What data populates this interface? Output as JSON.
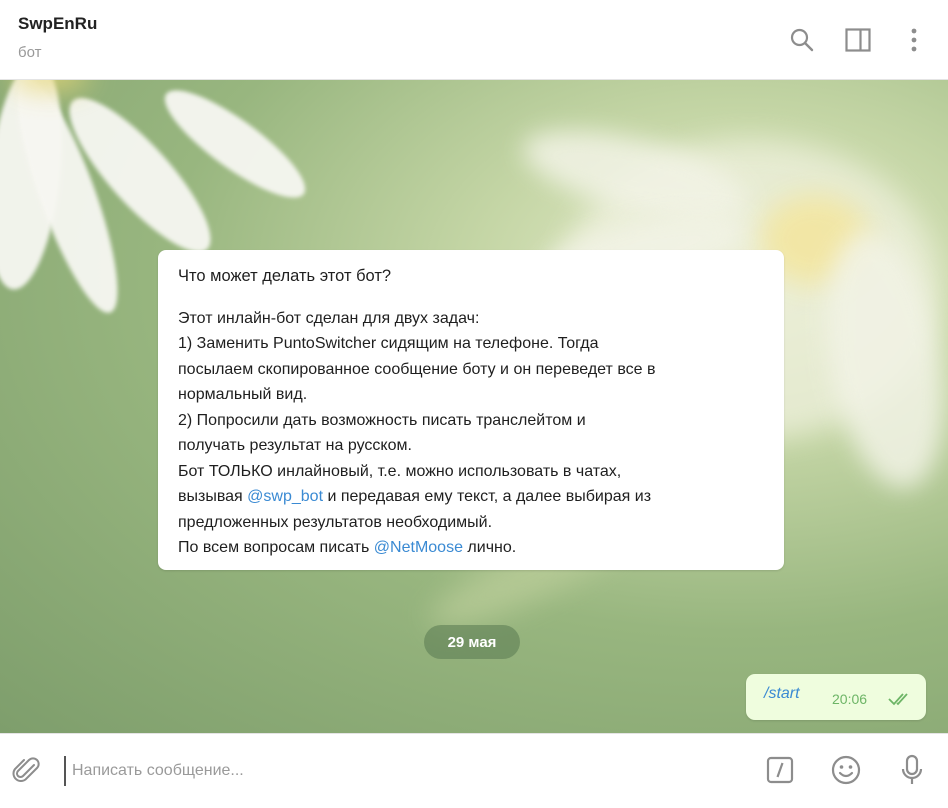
{
  "header": {
    "title": "SwpEnRu",
    "subtitle": "бот",
    "icons": [
      "search-icon",
      "sidebar-panel-icon",
      "more-vertical-icon"
    ]
  },
  "info_card": {
    "question": "Что может делать этот бот?",
    "line1": "Этот инлайн-бот сделан для двух задач:",
    "line2": "1) Заменить PuntoSwitcher сидящим на телефоне. Тогда",
    "line3": "посылаем скопированное сообщение боту и он переведет все в",
    "line4": "нормальный вид.",
    "line5": "2) Попросили дать возможность писать транслейтом и",
    "line6": "получать результат на русском.",
    "line7": "Бот ТОЛЬКО инлайновый, т.е. можно использовать в чатах,",
    "line8_pre": "вызывая ",
    "line8_link": "@swp_bot",
    "line8_post": " и передавая ему текст, а далее выбирая из",
    "line9": "предложенных результатов необходимый.",
    "line10_pre": "По всем вопросам писать ",
    "line10_link": "@NetMoose",
    "line10_post": " лично."
  },
  "date_separator": "29 мая",
  "outgoing_message": {
    "text": "/start",
    "time": "20:06",
    "status": "read"
  },
  "composer": {
    "placeholder": "Написать сообщение...",
    "icons": [
      "attach-icon",
      "bot-command-icon",
      "emoji-icon",
      "microphone-icon"
    ]
  },
  "colors": {
    "link": "#3a8ad3",
    "outgoing_bubble": "#effdde",
    "read_check": "#6db566",
    "icon_gray": "#8d8d8d"
  }
}
